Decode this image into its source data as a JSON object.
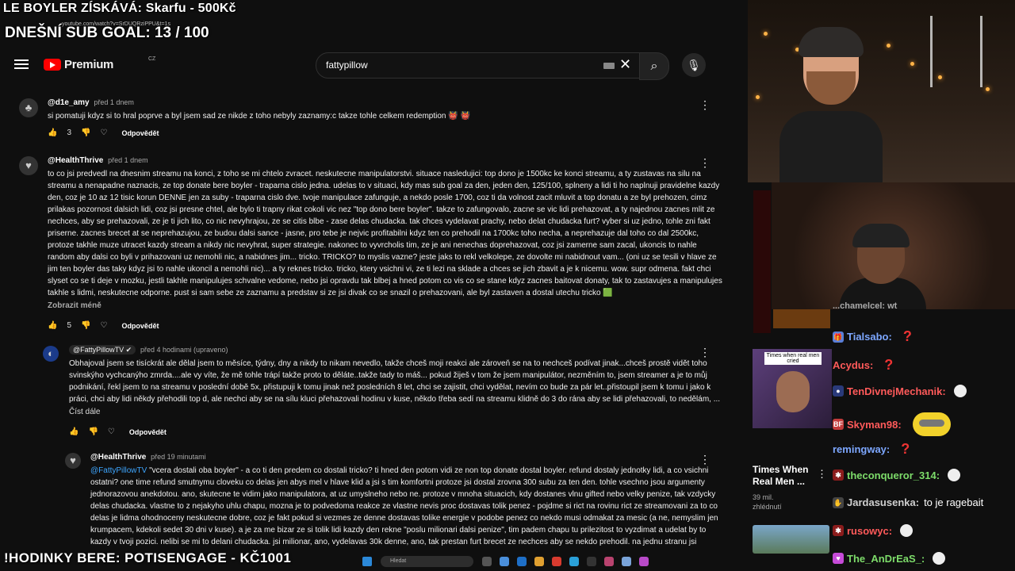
{
  "overlay": {
    "top_banner": "LE BOYLER ZÍSKÁVÁ: Skarfu - 500Kč",
    "url_hint": "youtube.com/watch?v=SrDUQRziPPU&t=1s",
    "goal": "DNEŠNÍ SUB GOAL: 13 / 100",
    "bottom_banner": "!HODINKY BERE: POTISENGAGE - KČ1001"
  },
  "youtube": {
    "logo_text": "Premium",
    "logo_country": "CZ",
    "search_value": "fattypillow",
    "clear_icon": "✕",
    "search_icon": "⌕",
    "mic_icon": "🎙"
  },
  "comments": [
    {
      "author": "@d1e_amy",
      "time": "před 1 dnem",
      "text": "si pomatuji kdyz si to hral poprve a byl jsem sad ze nikde z toho nebyly zaznamy:c takze tohle celkem redemption 👹 👹",
      "likes": "3",
      "reply": "Odpovědět"
    },
    {
      "author": "@HealthThrive",
      "time": "před 1 dnem",
      "text": "to co jsi predvedl na dnesnim streamu na konci, z toho se mi chtelo zvracet. neskutecne manipulatorstvi. situace nasledujici: top dono je 1500kc ke konci streamu, a ty zustavas na silu na streamu a nenapadne naznacis, ze top donate bere boyler - traparna cislo jedna. udelas to v situaci, kdy mas sub goal za den, jeden den, 125/100, splneny a lidi ti ho naplnuji pravidelne kazdy den, coz je 10 az 12 tisic korun DENNE jen za suby - traparna cislo dve. tvoje manipulace zafunguje, a nekdo posle 1700, coz ti da volnost zacit mluvit a top donatu a ze byl prehozen, cimz prilakas pozornost dalsich lidi, coz jsi presne chtel, ale bylo ti trapny rikat cokoli vic nez \"top dono bere boyler\". takze to zafungovalo, zacne se vic lidi prehazovat, a ty najednou zacnes mlit ze nechces, aby se prehazovali, ze je ti jich lito, co nic nevyhrajou, ze se citis blbe - zase delas chudacka. tak chces vydelavat prachy, nebo delat chudacka furt? vyber si uz jedno, tohle zni fakt priserne. zacnes brecet at se neprehazujou, ze budou dalsi sance - jasne, pro tebe je nejvic profitabilni kdyz ten co prehodil na 1700kc toho necha, a neprehazuje dal toho co dal 2500kc, protoze takhle muze utracet kazdy stream a nikdy nic nevyhrat, super strategie. nakonec to vyvrcholis tim, ze je ani nenechas doprehazovat, coz jsi zamerne sam zacal, ukoncis to nahle random aby dalsi co byli v prihazovani uz nemohli nic, a nabidnes jim... tricko. TRICKO? to myslis vazne? jeste jaks to rekl velkolepe, ze dovolte mi nabidnout vam... (oni uz se tesili v hlave ze jim ten boyler das taky kdyz jsi to nahle ukoncil a nemohli nic)... a ty reknes tricko. tricko, ktery vsichni vi, ze ti lezi na sklade a chces se jich zbavit a je k nicemu. wow. supr odmena. fakt chci slyset co se ti deje v mozku, jestli takhle manipulujes schvalne vedome, nebo jsi opravdu tak blbej a hned potom co vis co se stane kdyz zacnes baitovat donaty, tak to zastavujes a manipulujes takhle s lidmi, neskutecne odporne. pust si sam sebe ze zaznamu a predstav si ze jsi divak co se snazil o prehazovani, ale byl zastaven a dostal utechu tricko 🟩",
      "more": "Zobrazit méně",
      "likes": "5",
      "reply": "Odpovědět"
    },
    {
      "author": "@FattyPillowTV",
      "time": "před 4 hodinami (upraveno)",
      "text": "Obhajoval jsem se tisíckrát ale dělal jsem to měsíce, týdny, dny a nikdy to nikam nevedlo, takže chceš moji reakci ale zároveň se na to nechceš podívat jinak...chceš prostě vidět toho svinskýho vychcanýho zmrda....ale vy víte, že mě tohle trápí takže proto to děláte..takže tady to máš... pokud žiješ v tom že jsem manipulátor, nezměním to, jsem streamer a je to můj podnikání, řekl jsem to na streamu v poslední době 5x, přistupuji k tomu jinak než posledních 8 let, chci se zajistit, chci vydělat, nevím co bude za pár let..přistoupil jsem k tomu i jako k práci, chci aby lidi někdy přehodili top d, ale nechci aby se na sílu kluci přehazovali hodinu v kuse, někdo třeba sedí na streamu klidně do 3 do rána aby se lidi přehazovali, to nedělám, ...",
      "more": "Číst dále",
      "reply": "Odpovědět"
    },
    {
      "author": "@HealthThrive",
      "time": "před 19 minutami",
      "mention": "@FattyPillowTV",
      "text": "\"vcera dostali oba boyler\" - a co ti den predem co dostali tricko? ti hned den potom vidi ze non top donate dostal boyler. refund dostaly jednotky lidi, a co vsichni ostatni? one time refund smutnymu cloveku co delas jen abys mel v hlave klid a jsi s tim komfortni protoze jsi dostal zrovna 300 subu za ten den. tohle vsechno jsou argumenty jednorazovou anekdotou. ano, skutecne te vidim jako manipulatora, at uz umyslneho nebo ne. protoze v mnoha situacich, kdy dostanes vlnu gifted nebo velky penize, tak vzdycky delas chudacka. vlastne to z nejakyho uhlu chapu, mozna je to podvedoma reakce ze vlastne nevis proc dostavas tolik penez - pojdme si rict na rovinu rict ze streamovani za to co delas je lidma ohodnoceny neskutecne dobre, coz je fakt pokud si vezmes ze denne dostavas tolike energie v podobe penez co nekdo musi odmakat za mesic (a ne, nemyslim jen krumpacem, kdekoli sedet 30 dni v kuse). a je za me bizar ze si tolik lidi kazdy den rekne \"poslu milionari dalsi penize\", tim padem chapu tu prilezitost to vyzdimat a udelat by to kazdy v tvoji pozici. nelibi se mi to delani chudacka. jsi milionar, ano, vydelavas 30k denne, ano, tak prestan furt brecet ze nechces aby se nekdo prehodil. na jednu stranu jsi"
    }
  ],
  "sidebar_video": {
    "thumb_caption": "Times when real men cried",
    "title": "Times When Real Men ...",
    "views": "39 mil.",
    "views_label": "zhlédnutí"
  },
  "chat": [
    {
      "user": "Tialsabo:",
      "color": "#7da7ff",
      "emote": "question"
    },
    {
      "user": "Acydus:",
      "color": "#ff5a5a",
      "emote": "question"
    },
    {
      "user": "TenDivnejMechanik:",
      "color": "#ff5a5a",
      "emote": "skull"
    },
    {
      "user": "Skyman98:",
      "color": "#ff5a5a",
      "emote": "minion"
    },
    {
      "user": "remingway:",
      "color": "#7da7ff",
      "emote": "question"
    },
    {
      "user": "theconqueror_314:",
      "color": "#7ddc6a",
      "emote": "skull"
    },
    {
      "user": "Jardasusenka:",
      "color": "#d0d0d0",
      "text": "to je ragebait"
    },
    {
      "user": "rusowyc:",
      "color": "#ff5a5a",
      "emote": "skull"
    },
    {
      "user": "The_AnDrEaS_:",
      "color": "#7ddc6a",
      "emote": "skull"
    }
  ],
  "chat_partial_top": "...chamelcel: wt",
  "taskbar": {
    "search_placeholder": "Hledat"
  }
}
